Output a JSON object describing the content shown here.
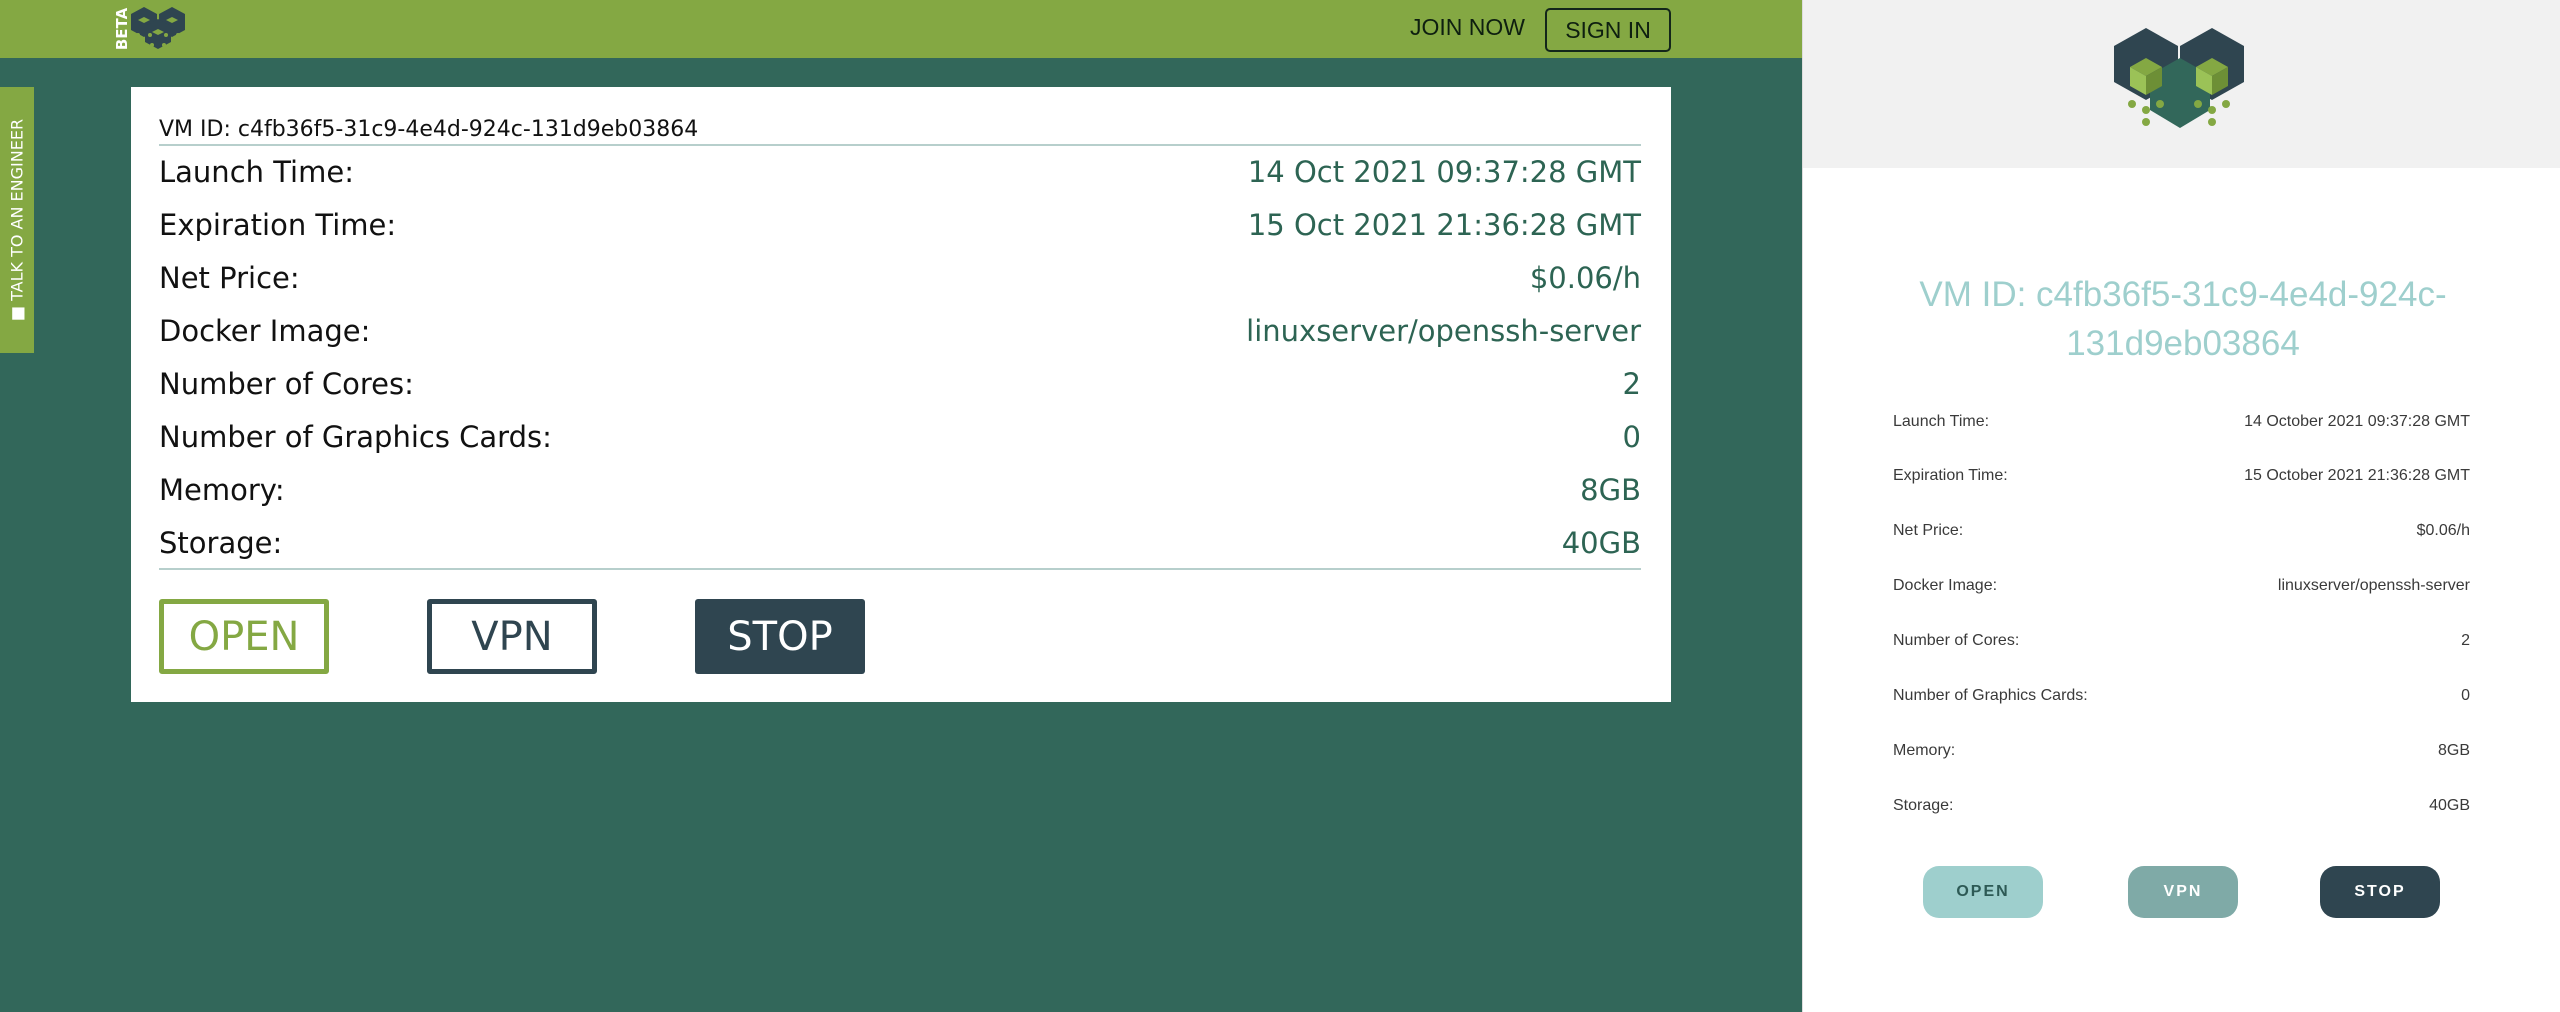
{
  "header": {
    "beta_label": "BETA",
    "join_label": "JOIN NOW",
    "signin_label": "SIGN IN"
  },
  "side_tab": {
    "label": "■ TALK TO AN ENGINEER"
  },
  "vm_card": {
    "vm_id": "VM ID: c4fb36f5-31c9-4e4d-924c-131d9eb03864",
    "rows": [
      {
        "key": "Launch Time:",
        "value": "14 Oct 2021 09:37:28 GMT"
      },
      {
        "key": "Expiration Time:",
        "value": "15 Oct 2021 21:36:28 GMT"
      },
      {
        "key": "Net Price:",
        "value": "$0.06/h"
      },
      {
        "key": "Docker Image:",
        "value": "linuxserver/openssh-server"
      },
      {
        "key": "Number of Cores:",
        "value": "2"
      },
      {
        "key": "Number of Graphics Cards:",
        "value": "0"
      },
      {
        "key": "Memory:",
        "value": "8GB"
      },
      {
        "key": "Storage:",
        "value": "40GB"
      }
    ],
    "buttons": {
      "open": "OPEN",
      "vpn": "VPN",
      "stop": "STOP"
    }
  },
  "panel": {
    "title": "VM ID: c4fb36f5-31c9-4e4d-924c-131d9eb03864",
    "rows": [
      {
        "key": "Launch Time:",
        "value": "14 October 2021 09:37:28 GMT"
      },
      {
        "key": "Expiration Time:",
        "value": "15 October 2021 21:36:28 GMT"
      },
      {
        "key": "Net Price:",
        "value": "$0.06/h"
      },
      {
        "key": "Docker Image:",
        "value": "linuxserver/openssh-server"
      },
      {
        "key": "Number of Cores:",
        "value": "2"
      },
      {
        "key": "Number of Graphics Cards:",
        "value": "0"
      },
      {
        "key": "Memory:",
        "value": "8GB"
      },
      {
        "key": "Storage:",
        "value": "40GB"
      }
    ],
    "buttons": {
      "open": "OPEN",
      "vpn": "VPN",
      "stop": "STOP"
    }
  },
  "colors": {
    "topbar": "#84a843",
    "background": "#32675a",
    "accent_dark": "#2f4550",
    "teal_light": "#9ecfcd"
  },
  "icons": {
    "logo": "hexagon-cube-logo-icon"
  }
}
